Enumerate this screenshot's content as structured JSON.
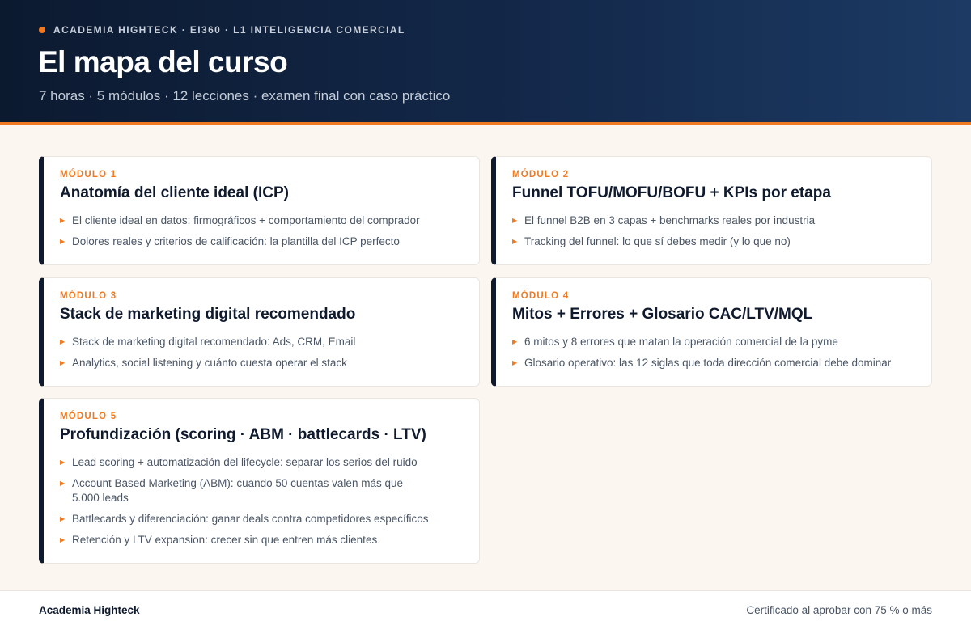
{
  "header": {
    "eyebrow": "ACADEMIA HIGHTECK · EI360 · L1 INTELIGENCIA COMERCIAL",
    "title": "El mapa del curso",
    "subtitle": "7 horas · 5 módulos · 12 lecciones · examen final con caso práctico"
  },
  "modules": [
    {
      "label": "MÓDULO 1",
      "title": "Anatomía del cliente ideal (ICP)",
      "items": [
        "El cliente ideal en datos: firmográficos + comportamiento del comprador",
        "Dolores reales y criterios de calificación: la plantilla del ICP perfecto"
      ]
    },
    {
      "label": "MÓDULO 2",
      "title": "Funnel TOFU/MOFU/BOFU + KPIs por etapa",
      "items": [
        "El funnel B2B en 3 capas + benchmarks reales por industria",
        "Tracking del funnel: lo que sí debes medir (y lo que no)"
      ]
    },
    {
      "label": "MÓDULO 3",
      "title": "Stack de marketing digital recomendado",
      "items": [
        "Stack de marketing digital recomendado: Ads, CRM, Email",
        "Analytics, social listening y cuánto cuesta operar el stack"
      ]
    },
    {
      "label": "MÓDULO 4",
      "title": "Mitos + Errores + Glosario CAC/LTV/MQL",
      "items": [
        "6 mitos y 8 errores que matan la operación comercial de la pyme",
        "Glosario operativo: las 12 siglas que toda dirección comercial debe dominar"
      ]
    },
    {
      "label": "MÓDULO 5",
      "title": "Profundización (scoring · ABM · battlecards · LTV)",
      "items": [
        "Lead scoring + automatización del lifecycle: separar los serios del ruido",
        "Account Based Marketing (ABM): cuando 50 cuentas valen más que 5.000 leads",
        "Battlecards y diferenciación: ganar deals contra competidores específicos",
        "Retención y LTV expansion: crecer sin que entren más clientes"
      ]
    }
  ],
  "footer": {
    "brand": "Academia Highteck",
    "note": "Certificado al aprobar con 75 % o más"
  },
  "colors": {
    "accent": "#f07a22",
    "navy": "#0f1a2e",
    "background": "#fcf6f1"
  }
}
